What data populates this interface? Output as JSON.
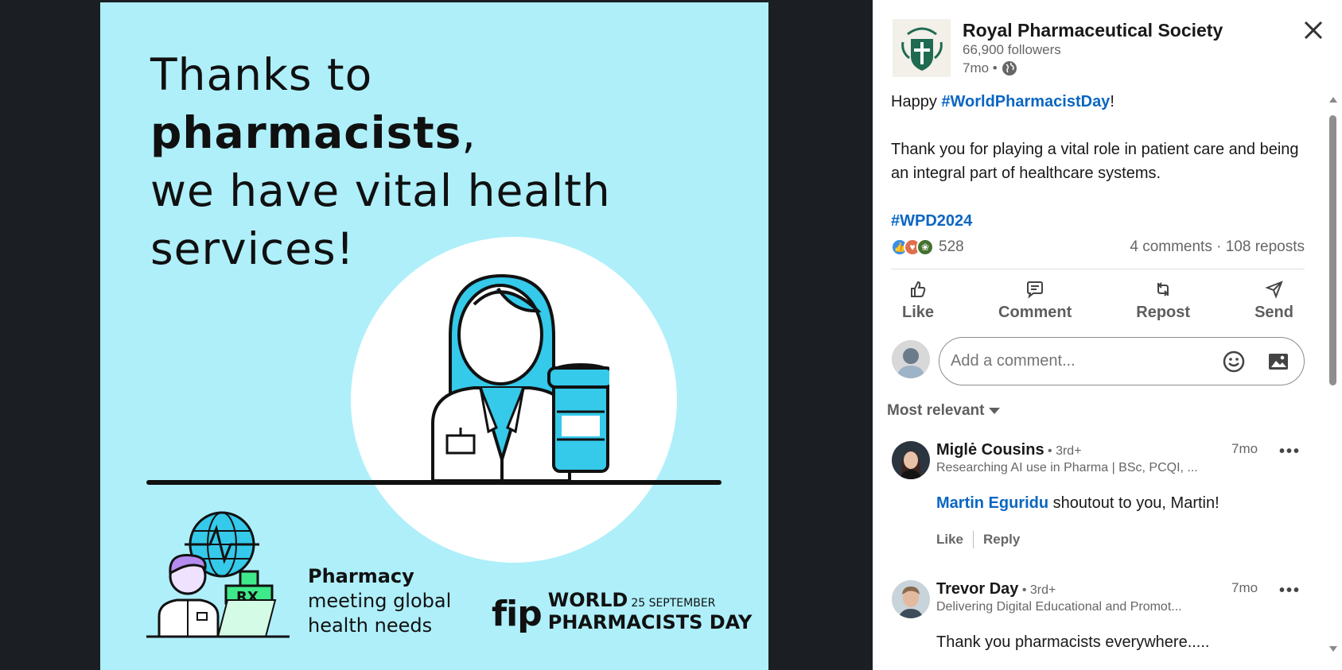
{
  "poster": {
    "headline_line1": "Thanks to",
    "headline_bold": "pharmacists",
    "headline_comma": ",",
    "headline_line3": "we have vital health",
    "headline_line4": "services!",
    "tagline_bold": "Pharmacy",
    "tagline_line2": "meeting global",
    "tagline_line3": "health needs",
    "fip_logo": "fip",
    "wpd_word": "WORLD",
    "wpd_date": "25 SEPTEMBER",
    "wpd_line2": "PHARMACISTS DAY",
    "rx_label": "RX",
    "colors": {
      "background": "#aeeffa",
      "accent": "#35c9ea",
      "green": "#3ee98a",
      "purple": "#b48cf0"
    }
  },
  "panel": {
    "org_name": "Royal Pharmaceutical Society",
    "followers": "66,900 followers",
    "age": "7mo •",
    "visibility_icon": "globe-icon",
    "close_icon": "close-icon"
  },
  "post": {
    "line1_prefix": "Happy ",
    "line1_hashtag": "#WorldPharmacistDay",
    "line1_suffix": "!",
    "line2": "Thank you for playing a vital role in patient care and being an integral part of healthcare systems.",
    "hashtag2": "#WPD2024"
  },
  "social": {
    "reaction_count": "528",
    "comments_reposts": "4 comments · 108 reposts"
  },
  "actions": {
    "like": "Like",
    "comment": "Comment",
    "repost": "Repost",
    "send": "Send"
  },
  "composer": {
    "placeholder": "Add a comment..."
  },
  "sort": {
    "label": "Most relevant"
  },
  "comments": [
    {
      "name": "Miglė Cousins",
      "degree": " • 3rd+",
      "headline": "Researching AI use in Pharma | BSc, PCQI, ...",
      "time": "7mo",
      "mention": "Martin Eguridu",
      "text": " shoutout to you, Martin!",
      "like": "Like",
      "reply": "Reply"
    },
    {
      "name": "Trevor Day",
      "degree": " • 3rd+",
      "headline": "Delivering Digital Educational and Promot...",
      "time": "7mo",
      "text": "Thank you pharmacists everywhere....."
    }
  ]
}
